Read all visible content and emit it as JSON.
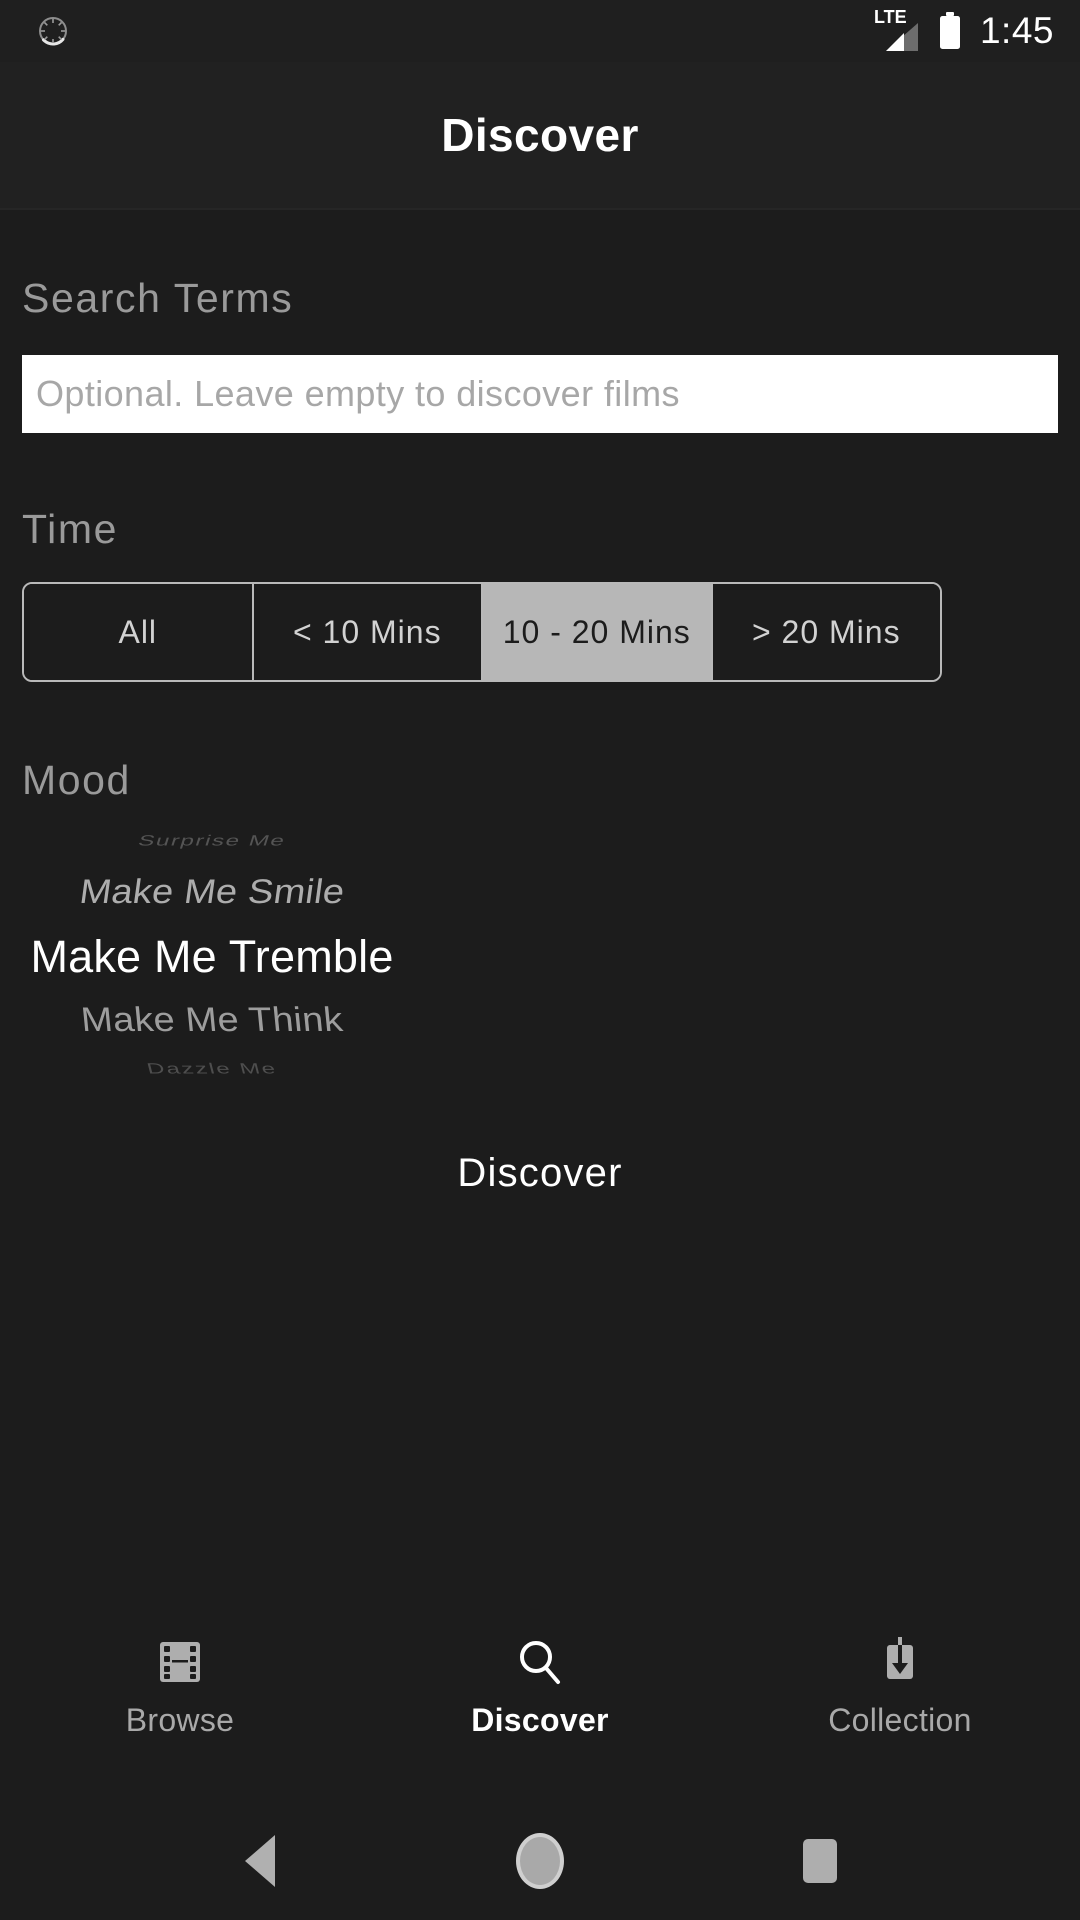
{
  "status_bar": {
    "sync_icon": "sync-spinner-icon",
    "network_label": "LTE",
    "signal_icon": "signal-bars-icon",
    "battery_icon": "battery-full-icon",
    "time": "1:45"
  },
  "header": {
    "title": "Discover"
  },
  "search": {
    "label": "Search Terms",
    "value": "",
    "placeholder": "Optional. Leave empty to discover films"
  },
  "time_filter": {
    "label": "Time",
    "selected": "10 - 20 Mins",
    "options": [
      {
        "label": "All",
        "selected": false
      },
      {
        "label": "< 10 Mins",
        "selected": false
      },
      {
        "label": "10 - 20 Mins",
        "selected": true
      },
      {
        "label": "> 20 Mins",
        "selected": false
      }
    ]
  },
  "mood": {
    "label": "Mood",
    "selected": "Make Me Tremble",
    "options": [
      {
        "label": "Surprise Me"
      },
      {
        "label": "Make Me Smile"
      },
      {
        "label": "Make Me Tremble"
      },
      {
        "label": "Make Me Think"
      },
      {
        "label": "Dazzle Me"
      }
    ]
  },
  "actions": {
    "discover_label": "Discover"
  },
  "bottom_nav": {
    "items": [
      {
        "label": "Browse",
        "icon": "film-strip-icon",
        "active": false
      },
      {
        "label": "Discover",
        "icon": "search-icon",
        "active": true
      },
      {
        "label": "Collection",
        "icon": "download-icon",
        "active": false
      }
    ]
  },
  "android_nav": {
    "back": "back-triangle-icon",
    "home": "home-circle-icon",
    "recents": "recents-square-icon"
  },
  "colors": {
    "page_background": "#1c1c1c",
    "header_background": "#212121",
    "accent_selected": "#b7b7b7",
    "text_primary": "#ffffff",
    "text_muted": "#9a9a9a",
    "input_background": "#ffffff"
  }
}
